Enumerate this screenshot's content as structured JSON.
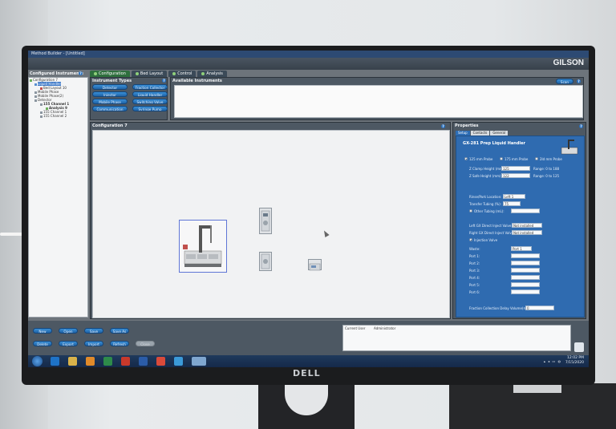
{
  "app": {
    "window_title": "Method Builder - [Untitled]",
    "brand": "GILSON",
    "tabs": [
      {
        "label": "Configuration"
      },
      {
        "label": "Bed Layout"
      },
      {
        "label": "Control"
      },
      {
        "label": "Analysis"
      }
    ]
  },
  "left_panel": {
    "header": "Configured Instruments",
    "tree": [
      {
        "label": "Configuration 7",
        "level": 0,
        "selected": false
      },
      {
        "label": "Liquid Handler",
        "level": 1,
        "selected": true
      },
      {
        "label": "Bed Layout 10",
        "level": 2,
        "selected": false
      },
      {
        "label": "Mobile Phase",
        "level": 1,
        "selected": false
      },
      {
        "label": "Mobile Phase(2)",
        "level": 1,
        "selected": false
      },
      {
        "label": "Detector",
        "level": 1,
        "selected": false
      },
      {
        "label": "155 Channel 1",
        "level": 2,
        "selected": false
      },
      {
        "label": "Analysis 9",
        "level": 3,
        "selected": false
      },
      {
        "label": "155 Channel 1",
        "level": 2,
        "selected": false
      },
      {
        "label": "155 Channel 2",
        "level": 2,
        "selected": false
      }
    ]
  },
  "instrument_types": {
    "title": "Instrument Types",
    "buttons": [
      "Detector",
      "Fraction Collector",
      "Injector",
      "Liquid Handler",
      "Mobile Phase",
      "Switching Valve",
      "Communication",
      "Syringe Pump"
    ]
  },
  "available_instruments": {
    "title": "Available Instruments",
    "scan_label": "Scan"
  },
  "configuration": {
    "title": "Configuration 7"
  },
  "properties": {
    "title": "Properties",
    "tabs": [
      "Setup",
      "Contacts",
      "General"
    ],
    "device_title": "GX-281 Prep Liquid Handler",
    "probe_options": [
      "125 mm Probe",
      "175 mm Probe",
      "2ld mm Probe"
    ],
    "z_clamp_label": "Z Clamp Height (mm):",
    "z_clamp_value": "125",
    "z_clamp_range": "Range: 0 to 188",
    "z_safe_label": "Z Safe Height (mm):",
    "z_safe_value": "122",
    "z_safe_range": "Range: 0 to 125",
    "rinse_label": "Rinse/Park Location:",
    "rinse_value": "Left 1",
    "transfer_label": "Transfer Tubing (%):",
    "transfer_value": "75",
    "other_tubing_label": "Other Tubing (mL):",
    "left_inject_label": "Left GX Direct Inject Valve:",
    "left_inject_value": "Not installed",
    "right_inject_label": "Right GX Direct Inject Valve:",
    "right_inject_value": "Not installed",
    "injection_valve_label": "Injection Valve",
    "waste_label": "Waste:",
    "waste_value": "Port 1",
    "ports": [
      "Port 1:",
      "Port 2:",
      "Port 3:",
      "Port 4:",
      "Port 5:",
      "Port 6:"
    ],
    "fraction_delay_label": "Fraction Collection Delay Volume(mL):",
    "fraction_delay_value": "0"
  },
  "bottom_buttons": {
    "row1": [
      "New",
      "Open",
      "Save",
      "Save As"
    ],
    "row2": [
      "Delete",
      "Export",
      "Import",
      "Refresh",
      "Close"
    ]
  },
  "status": {
    "user_label": "Current User",
    "user_value": "Administrator"
  },
  "taskbar": {
    "time": "12:02 PM",
    "date": "7/15/2020"
  },
  "monitor": {
    "brand": "DELL"
  }
}
